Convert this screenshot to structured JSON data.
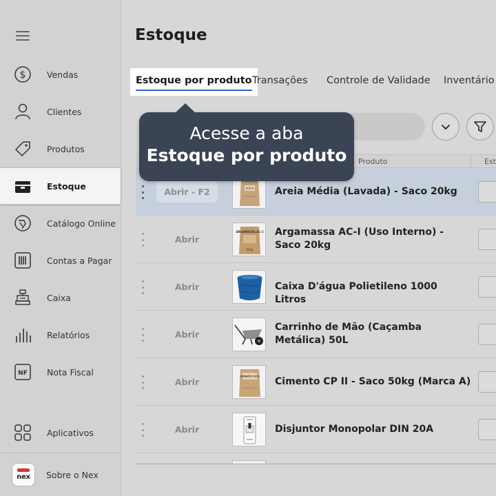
{
  "sidebar": {
    "items": [
      {
        "label": "Vendas",
        "icon": "dollar-circle-icon"
      },
      {
        "label": "Clientes",
        "icon": "user-icon"
      },
      {
        "label": "Produtos",
        "icon": "tag-icon"
      },
      {
        "label": "Estoque",
        "icon": "box-icon",
        "active": true
      },
      {
        "label": "Catálogo Online",
        "icon": "catalog-icon"
      },
      {
        "label": "Contas a Pagar",
        "icon": "barcode-icon"
      },
      {
        "label": "Caixa",
        "icon": "cash-register-icon"
      },
      {
        "label": "Relatórios",
        "icon": "bar-chart-icon"
      },
      {
        "label": "Nota Fiscal",
        "icon": "nf-icon"
      },
      {
        "label": "Aplicativos",
        "icon": "apps-grid-icon"
      }
    ],
    "about": {
      "label": "Sobre o Nex",
      "logo_text": "nex"
    }
  },
  "header": {
    "title": "Estoque"
  },
  "tabs": [
    {
      "label": "Estoque por produto",
      "active": true
    },
    {
      "label": "Transações"
    },
    {
      "label": "Controle de Validade"
    },
    {
      "label": "Inventário"
    }
  ],
  "tooltip": {
    "line1": "Acesse a aba",
    "line2": "Estoque por produto"
  },
  "table": {
    "columns": [
      "Produto",
      "Est"
    ],
    "rows": [
      {
        "action": "Abrir - F2",
        "name": "Areia Média (Lavada) - Saco 20kg",
        "selected": true
      },
      {
        "action": "Abrir",
        "name": "Argamassa AC-I (Uso Interno) - Saco 20kg"
      },
      {
        "action": "Abrir",
        "name": "Caixa D'água Polietileno 1000 Litros"
      },
      {
        "action": "Abrir",
        "name": "Carrinho de Mão (Caçamba Metálica) 50L"
      },
      {
        "action": "Abrir",
        "name": "Cimento CP II - Saco 50kg (Marca A)"
      },
      {
        "action": "Abrir",
        "name": "Disjuntor Monopolar DIN 20A"
      }
    ]
  },
  "product_images": {
    "bag1_label": "AREIA",
    "bag2_label": "ARGAMASSA AC-1",
    "bag2_weight": "20kg",
    "bag3_label": "CIMENTO CP II"
  },
  "colors": {
    "accent": "#2f66c8",
    "tooltip_bg": "#3b4454",
    "selected_row": "#c6d0dc",
    "brand_red": "#d8332f"
  }
}
